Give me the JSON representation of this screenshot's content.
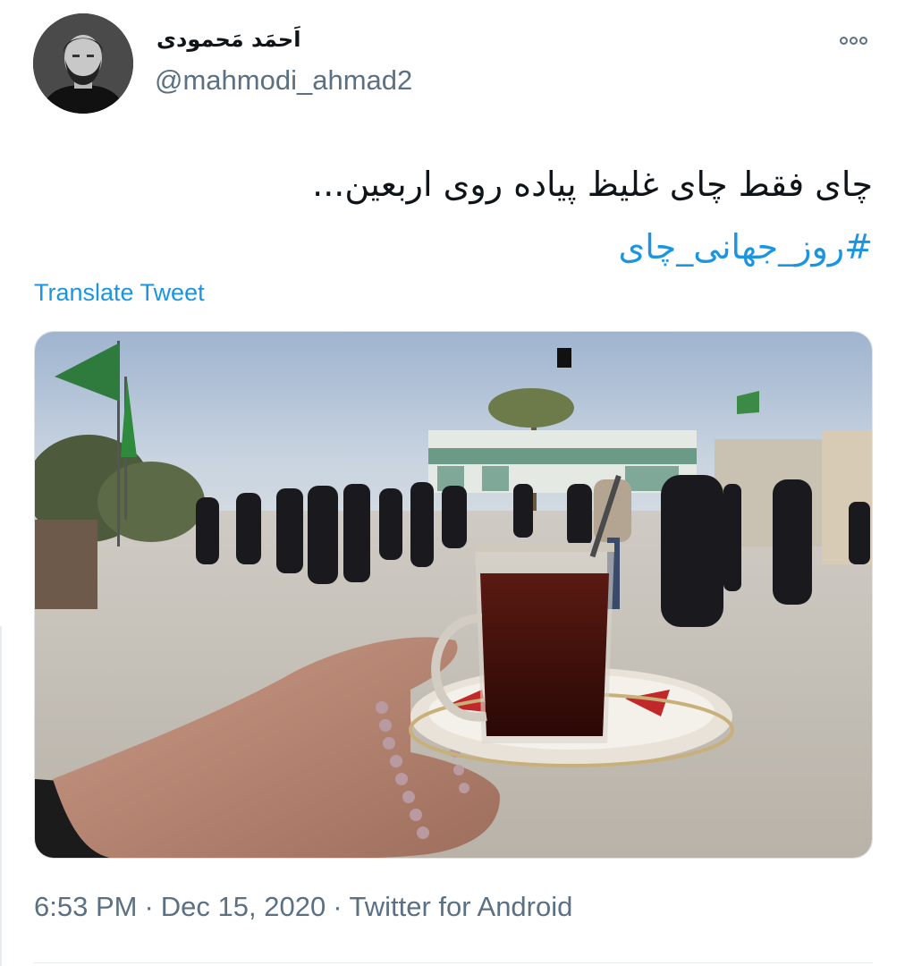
{
  "tweet": {
    "display_name": "اَحمَد مَحمودی",
    "handle": "@mahmodi_ahmad2",
    "text": "چای فقط چای غلیظ پیاده روی اربعین...",
    "hashtag": "#روز_جهانی_چای",
    "translate_label": "Translate Tweet",
    "time": "6:53 PM",
    "date": "Dec 15, 2020",
    "separator": "·",
    "source": "Twitter for Android"
  },
  "icons": {
    "more": "more-options-icon"
  },
  "colors": {
    "link": "#1b95e0",
    "secondary_text": "#5b7083",
    "primary_text": "#0f1419"
  }
}
